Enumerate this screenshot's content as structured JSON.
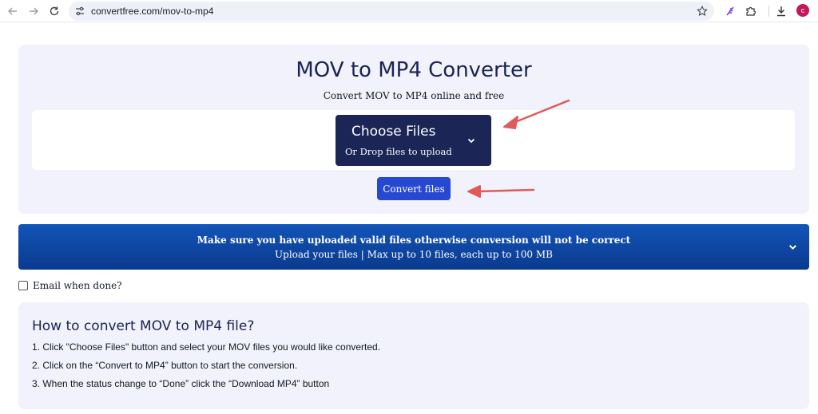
{
  "browser": {
    "url": "convertfree.com/mov-to-mp4",
    "avatar_letter": "c"
  },
  "hero": {
    "title": "MOV to MP4 Converter",
    "subtitle": "Convert MOV to MP4 online and free",
    "choose_label": "Choose Files",
    "drop_label": "Or Drop files to upload",
    "convert_label": "Convert files"
  },
  "banner": {
    "line1": "Make sure you have uploaded valid files otherwise conversion will not be correct",
    "line2": "Upload your files | Max up to 10 files, each up to 100 MB"
  },
  "email": {
    "label": "Email when done?",
    "checked": false
  },
  "howto": {
    "title": "How to convert MOV to MP4 file?",
    "steps": [
      "1. Click \"Choose Files\" button and select your MOV files you would like converted.",
      "2. Click on the “Convert to MP4” button to start the conversion.",
      "3. When the status change to “Done” click the “Download MP4” button"
    ]
  },
  "colors": {
    "accent_dark": "#1b2556",
    "button_blue": "#2748d0",
    "annotation_arrow": "#e05a5a"
  }
}
